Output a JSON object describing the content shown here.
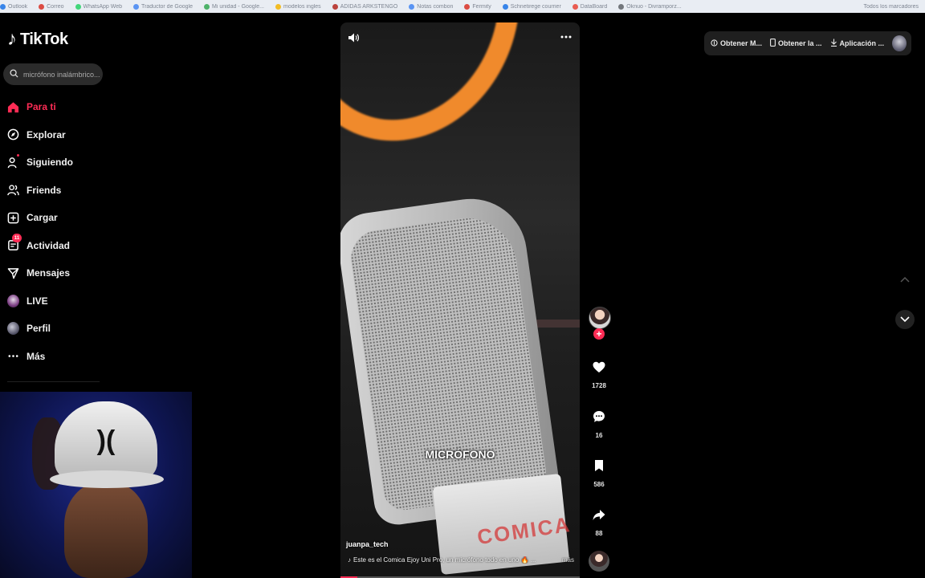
{
  "bookmarks": [
    "Outlook",
    "Correo",
    "WhatsApp Web",
    "Traductor de Google",
    "Mi unidad - Google...",
    "modelos ingles",
    "ADIDAS ARKSTENGO",
    "Notas combon",
    "Fermity",
    "Schnetirege courrier",
    "DataBoard",
    "Oknuo - Divramporz..."
  ],
  "bookmarks_right": "Todos los marcadores",
  "logo": {
    "text": "TikTok"
  },
  "search": {
    "placeholder": "micrófono inalámbrico..."
  },
  "nav": {
    "items": [
      {
        "label": "Para ti"
      },
      {
        "label": "Explorar"
      },
      {
        "label": "Siguiendo"
      },
      {
        "label": "Friends"
      },
      {
        "label": "Cargar"
      },
      {
        "label": "Actividad",
        "badge": "11"
      },
      {
        "label": "Mensajes"
      },
      {
        "label": "LIVE"
      },
      {
        "label": "Perfil"
      },
      {
        "label": "Más"
      }
    ]
  },
  "video": {
    "overlay_text": "MICRÓFONO",
    "author": "juanpa_tech",
    "description": "Este es el Comica Ejoy Uni Pro, un micrófono todo en uno 🔥 ...",
    "more": "más",
    "brand_mark": "COMICA",
    "progress": 0.07
  },
  "actions": {
    "likes": "1728",
    "comments": "16",
    "saves": "586",
    "shares": "88"
  },
  "topbar": {
    "item1": "Obtener M...",
    "item2": "Obtener la ...",
    "item3": "Aplicación ..."
  },
  "colors": {
    "accent": "#fe2c55",
    "background": "#000000",
    "ring": "#f08a2c"
  }
}
